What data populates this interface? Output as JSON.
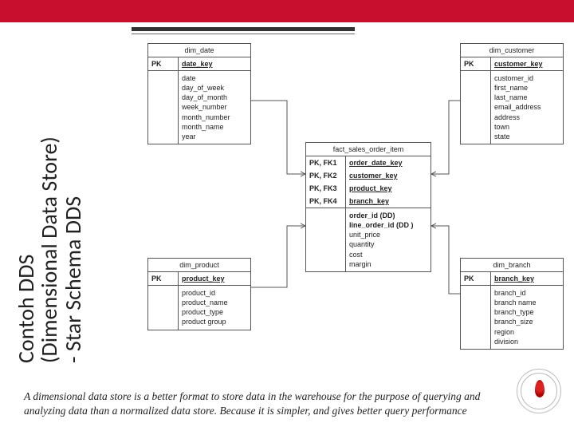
{
  "slide": {
    "title_line1": "Contoh DDS",
    "title_line2": "(Dimensional Data Store)",
    "title_line3": "- Star Schema DDS"
  },
  "entities": {
    "dim_date": {
      "name": "dim_date",
      "pk_label": "PK",
      "pk_name": "date_key",
      "attrs": [
        "date",
        "day_of_week",
        "day_of_month",
        "week_number",
        "month_number",
        "month_name",
        "year"
      ]
    },
    "dim_customer": {
      "name": "dim_customer",
      "pk_label": "PK",
      "pk_name": "customer_key",
      "attrs": [
        "customer_id",
        "first_name",
        "last_name",
        "email_address",
        "address",
        "town",
        "state"
      ]
    },
    "dim_product": {
      "name": "dim_product",
      "pk_label": "PK",
      "pk_name": "product_key",
      "attrs": [
        "product_id",
        "product_name",
        "product_type",
        "product group"
      ]
    },
    "dim_branch": {
      "name": "dim_branch",
      "pk_label": "PK",
      "pk_name": "branch_key",
      "attrs": [
        "branch_id",
        "branch name",
        "branch_type",
        "branch_size",
        "region",
        "division"
      ]
    },
    "fact": {
      "name": "fact_sales_order_item",
      "pkfk": [
        {
          "l": "PK, FK1",
          "r": "order_date_key"
        },
        {
          "l": "PK, FK2",
          "r": "customer_key"
        },
        {
          "l": "PK, FK3",
          "r": "product_key"
        },
        {
          "l": "PK, FK4",
          "r": "branch_key"
        }
      ],
      "measures": [
        "order_id (DD)",
        "line_order_id (DD )",
        "unit_price",
        "quantity",
        "cost",
        "margin"
      ]
    }
  },
  "footer": {
    "text": "A dimensional data store is a better format to store data in the warehouse for the purpose of querying and analyzing data than a normalized data store. Because it is simpler, and gives better query performance"
  }
}
